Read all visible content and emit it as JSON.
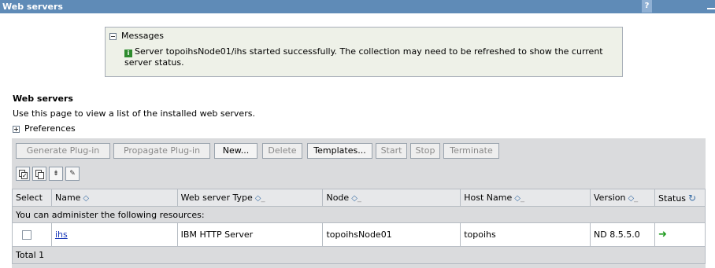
{
  "titlebar": {
    "title": "Web servers",
    "help": "?"
  },
  "messages": {
    "header": "Messages",
    "info_icon": "i",
    "text": "Server topoihsNode01/ihs started successfully. The collection may need to be refreshed to show the current server status."
  },
  "page": {
    "title": "Web servers",
    "description": "Use this page to view a list of the installed web servers.",
    "preferences": "Preferences"
  },
  "buttons": [
    {
      "label": "Generate Plug-in",
      "enabled": false
    },
    {
      "label": "Propagate Plug-in",
      "enabled": false
    },
    {
      "label": "New...",
      "enabled": true
    },
    {
      "label": "Delete",
      "enabled": false
    },
    {
      "label": "Templates...",
      "enabled": true
    },
    {
      "label": "Start",
      "enabled": false
    },
    {
      "label": "Stop",
      "enabled": false
    },
    {
      "label": "Terminate",
      "enabled": false
    }
  ],
  "toolbar_icons": [
    "select-all-icon",
    "deselect-all-icon",
    "show-filter-icon",
    "clear-filter-icon"
  ],
  "table": {
    "headers": {
      "select": "Select",
      "name": "Name",
      "type": "Web server Type",
      "node": "Node",
      "host": "Host Name",
      "version": "Version",
      "status": "Status"
    },
    "group_label": "You can administer the following resources:",
    "rows": [
      {
        "name": "ihs",
        "type": "IBM HTTP Server",
        "node": "topoihsNode01",
        "host": "topoihs",
        "version": "ND 8.5.5.0",
        "status": "started"
      }
    ],
    "total": "Total 1"
  },
  "colors": {
    "titlebar": "#5f8bb7",
    "status_started": "#1f9b1f",
    "link": "#1535b8"
  }
}
